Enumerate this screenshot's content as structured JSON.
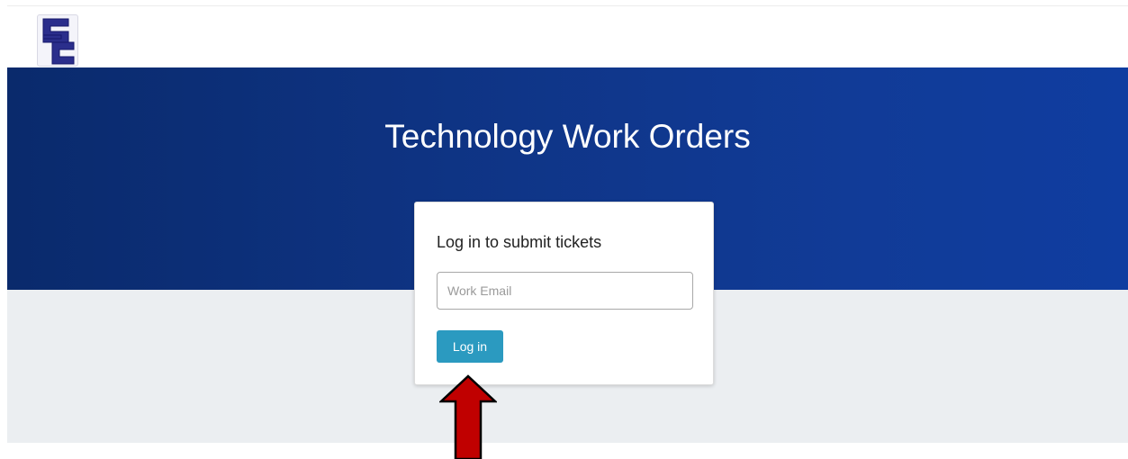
{
  "header": {
    "logo_icon": "sc-monogram-logo-icon"
  },
  "hero": {
    "title": "Technology Work Orders"
  },
  "login_card": {
    "title": "Log in to submit tickets",
    "email_placeholder": "Work Email",
    "email_value": "",
    "login_button_label": "Log in"
  },
  "annotation": {
    "arrow_icon": "red-up-arrow-icon",
    "arrow_color": "#c00000"
  },
  "colors": {
    "hero_blue": "#0f3587",
    "button_teal": "#2b9ac0",
    "logo_navy": "#2b2e8c"
  }
}
